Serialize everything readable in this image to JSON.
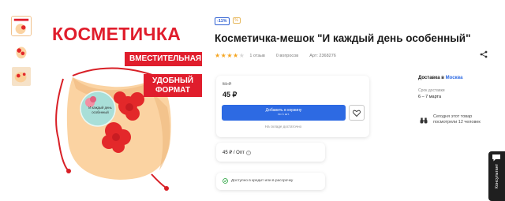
{
  "gallery": {
    "banner_title": "КОСМЕТИЧКА",
    "tag_capacious": "ВМЕСТИТЕЛЬНАЯ",
    "tag_convenient_line1": "УДОБНЫЙ",
    "tag_convenient_line2": "ФОРМАТ",
    "pouch_print_line1": "И каждый день",
    "pouch_print_line2": "особенный",
    "colors": {
      "brand_red": "#e01d2c",
      "pouch_peach": "#fbd3a2",
      "flower_red": "#e3282a"
    }
  },
  "product": {
    "discount_badge": "-11%",
    "title": "Косметичка-мешок \"И каждый день особенный\"",
    "rating": 4,
    "rating_max": 5,
    "reviews": "1 отзыв",
    "questions": "0 вопросов",
    "article": "Арт: 2368276"
  },
  "purchase": {
    "old_price": "51 ₽",
    "price": "45 ₽",
    "add_to_cart_label": "Добавить в корзину",
    "add_to_cart_sub": "по 1 шт.",
    "stock_note": "На складе достаточно",
    "wholesale_label": "45 ₽ / Опт",
    "credit_note": "Доступно в кредит или в рассрочку"
  },
  "delivery": {
    "title_prefix": "Доставка в",
    "city": "Москва",
    "term_label": "Срок доставки",
    "term_value": "6 – 7 марта",
    "viewers_text": "Сегодня этот товар посмотрели 12 человек"
  },
  "consultant": {
    "label": "Консультант"
  },
  "accent_colors": {
    "primary_blue": "#2d6ae3",
    "star_yellow": "#f5a623"
  }
}
